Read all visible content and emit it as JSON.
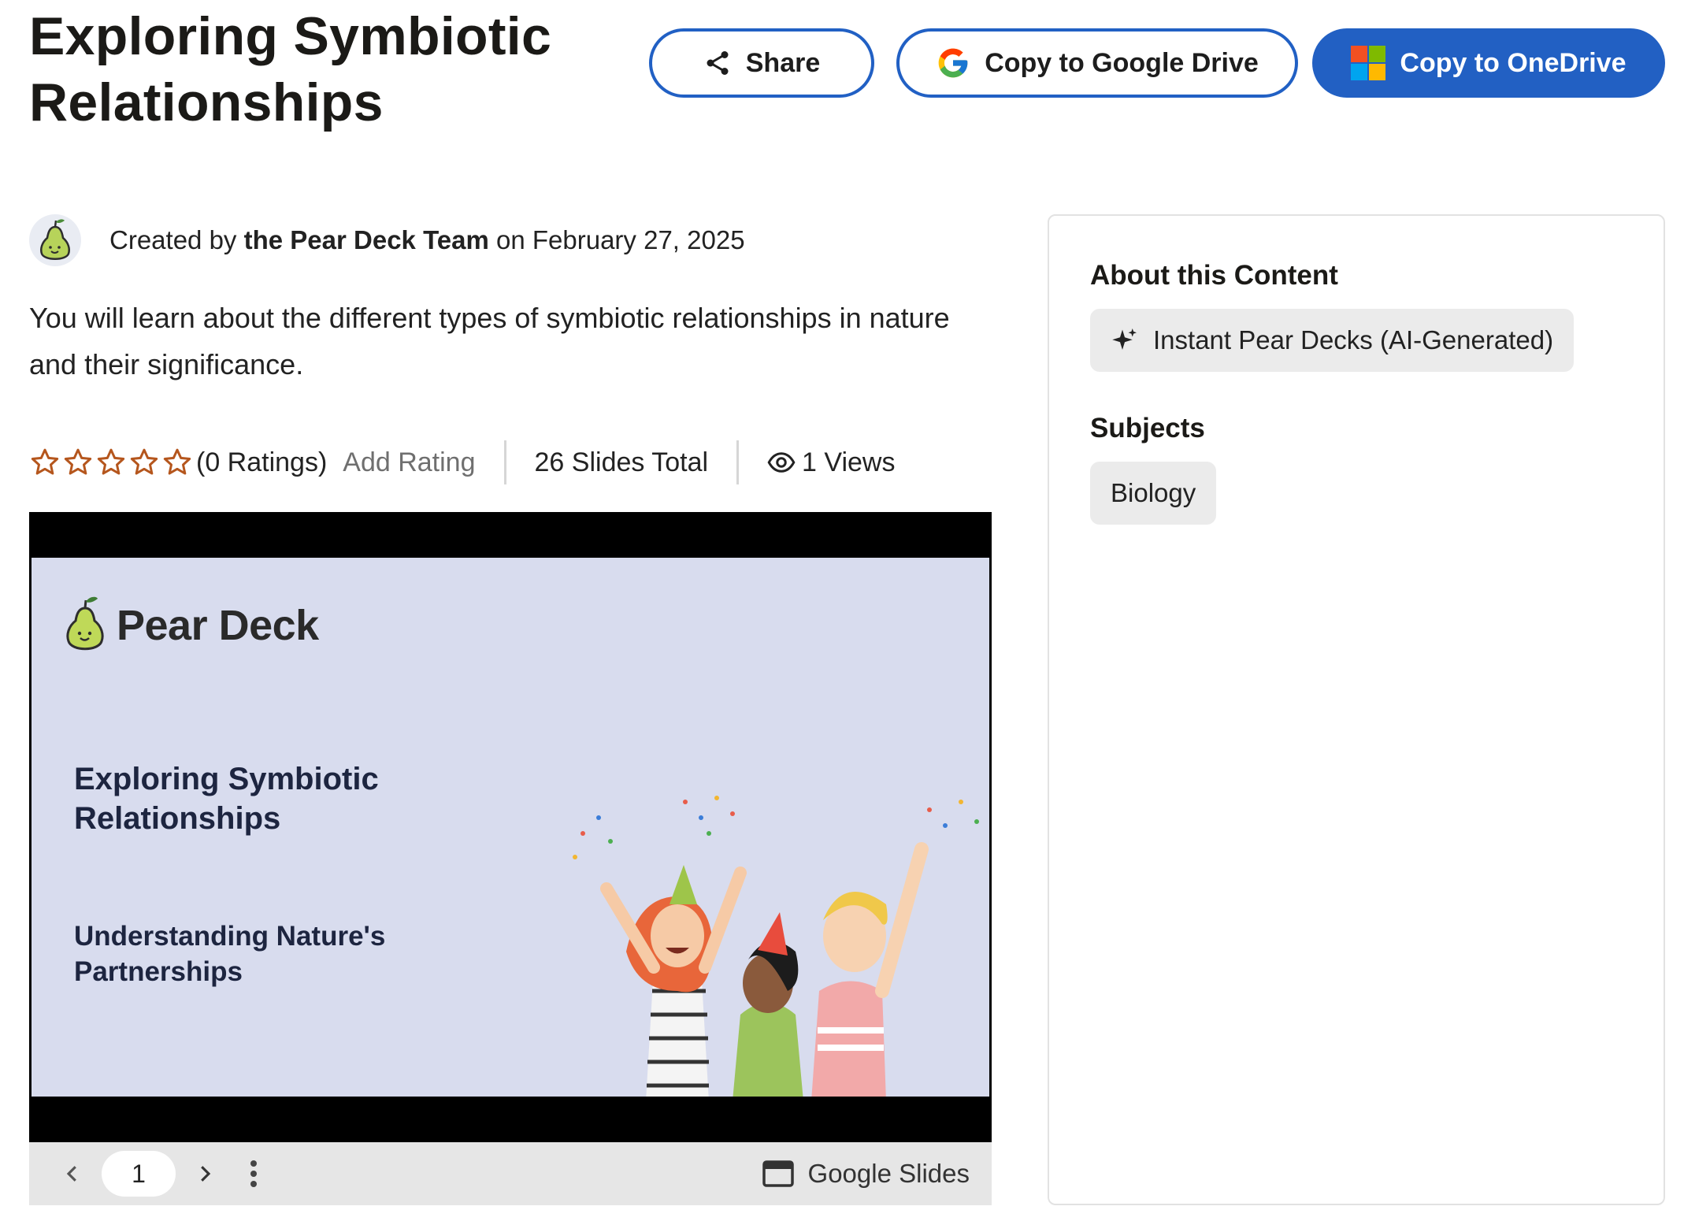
{
  "page": {
    "title": "Exploring Symbiotic Relationships"
  },
  "actions": {
    "share_label": "Share",
    "google_drive_label": "Copy to Google Drive",
    "onedrive_label": "Copy to OneDrive"
  },
  "creator": {
    "prefix": "Created by",
    "name": "the Pear Deck Team",
    "date_text": "on February 27, 2025"
  },
  "description": "You will learn about the different types of symbiotic relationships in nature and their significance.",
  "stats": {
    "rating_value": 0,
    "stars_total": 5,
    "ratings_count": "(0 Ratings)",
    "add_rating_label": "Add Rating",
    "slides_total": "26 Slides Total",
    "views": "1 Views"
  },
  "slide": {
    "brand": "Pear Deck",
    "title": "Exploring Symbiotic Relationships",
    "subtitle": "Understanding Nature's Partnerships"
  },
  "viewer": {
    "current_page": "1",
    "provider": "Google Slides"
  },
  "about": {
    "heading": "About this Content",
    "content_type": "Instant Pear Decks (AI-Generated)",
    "subjects_heading": "Subjects",
    "subjects": [
      "Biology"
    ]
  },
  "colors": {
    "primary_blue": "#2260c3",
    "star_outline": "#b5561d",
    "slide_background": "#d8dcee"
  },
  "icons": {
    "share": "share-icon",
    "google": "google-g-icon",
    "onedrive": "microsoft-logo-icon",
    "sparkle": "sparkle-icon",
    "eye": "eye-icon",
    "prev": "chevron-left-icon",
    "next": "chevron-right-icon",
    "more": "more-vertical-icon",
    "slides": "google-slides-icon"
  }
}
